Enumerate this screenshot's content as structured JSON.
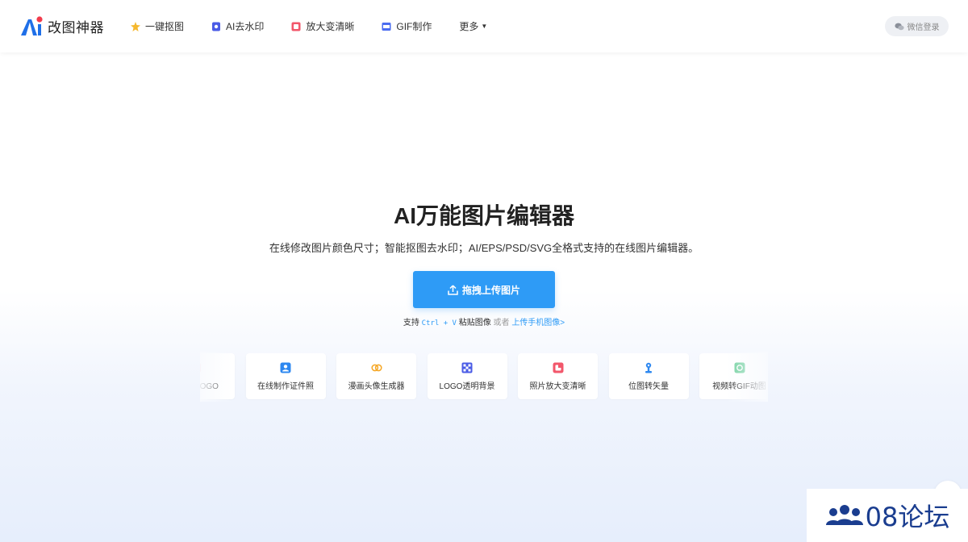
{
  "header": {
    "logo_text": "改图神器",
    "nav": [
      {
        "label": "一键抠图",
        "icon": "magic-wand-icon"
      },
      {
        "label": "AI去水印",
        "icon": "watermark-icon"
      },
      {
        "label": "放大变清晰",
        "icon": "enlarge-icon"
      },
      {
        "label": "GIF制作",
        "icon": "gif-icon"
      },
      {
        "label": "更多",
        "icon": "chevron-down-icon"
      }
    ],
    "login_label": "微信登录"
  },
  "hero": {
    "title": "AI万能图片编辑器",
    "subtitle": "在线修改图片颜色尺寸；智能抠图去水印；AI/EPS/PSD/SVG全格式支持的在线图片编辑器。",
    "upload_label": "拖拽上传图片",
    "hint": {
      "prefix": "支持",
      "kbd": "Ctrl + V",
      "middle": "粘贴图像",
      "or": "或者",
      "link": "上传手机图像>"
    }
  },
  "tools": [
    {
      "label": "去水印LOGO",
      "icon": "plus-square-icon",
      "color": "#f2576b"
    },
    {
      "label": "在线制作证件照",
      "icon": "id-photo-icon",
      "color": "#2e88f0"
    },
    {
      "label": "漫画头像生成器",
      "icon": "cartoon-icon",
      "color": "#f5a623"
    },
    {
      "label": "LOGO透明背景",
      "icon": "transparent-icon",
      "color": "#4a5be6"
    },
    {
      "label": "照片放大变清晰",
      "icon": "enlarge-icon",
      "color": "#f2576b"
    },
    {
      "label": "位图转矢量",
      "icon": "vector-icon",
      "color": "#2e88f0"
    },
    {
      "label": "视频转GIF动图",
      "icon": "video-gif-icon",
      "color": "#3cbf7a"
    }
  ],
  "watermark": {
    "text": "08论坛"
  },
  "colors": {
    "accent": "#2e9bf6",
    "brand_blue": "#1a3d8f"
  }
}
